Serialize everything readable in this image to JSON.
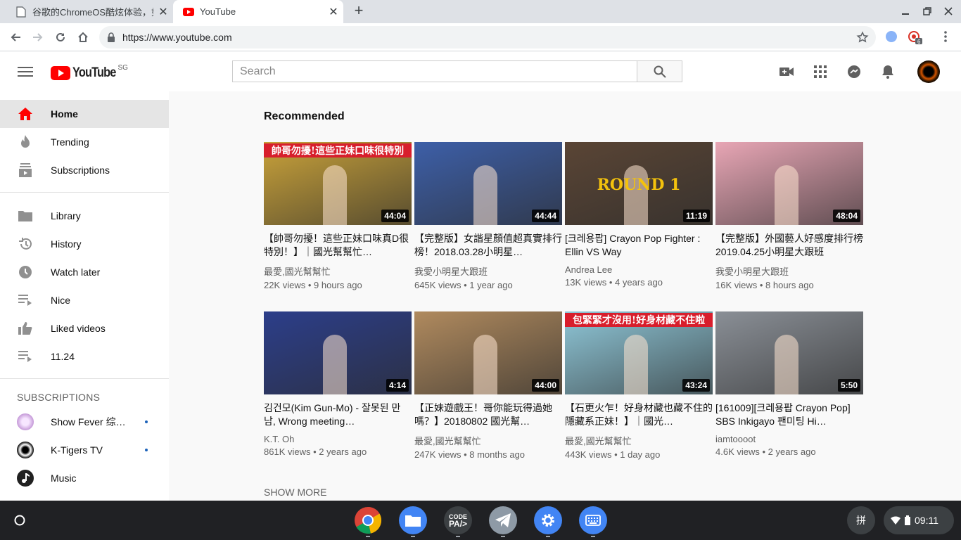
{
  "browser": {
    "tabs": [
      {
        "title": "谷歌的ChromeOS酷炫体验，如",
        "active": false
      },
      {
        "title": "YouTube",
        "active": true
      }
    ],
    "url": "https://www.youtube.com"
  },
  "header": {
    "logo_text": "YouTube",
    "region": "SG",
    "search_placeholder": "Search"
  },
  "sidebar": {
    "items": [
      {
        "label": "Home",
        "icon": "home-icon",
        "selected": true
      },
      {
        "label": "Trending",
        "icon": "trending-icon"
      },
      {
        "label": "Subscriptions",
        "icon": "subscriptions-icon"
      },
      {
        "label": "Library",
        "icon": "library-icon"
      },
      {
        "label": "History",
        "icon": "history-icon"
      },
      {
        "label": "Watch later",
        "icon": "watch-later-icon"
      },
      {
        "label": "Nice",
        "icon": "playlist-icon"
      },
      {
        "label": "Liked videos",
        "icon": "thumbs-up-icon"
      },
      {
        "label": "11.24",
        "icon": "playlist-icon"
      }
    ],
    "subscriptions_title": "SUBSCRIPTIONS",
    "subscriptions": [
      {
        "label": "Show Fever 综…",
        "new": true
      },
      {
        "label": "K-Tigers TV",
        "new": true
      },
      {
        "label": "Music",
        "new": false
      }
    ]
  },
  "main": {
    "section_title": "Recommended",
    "videos": [
      {
        "title": "【帥哥勿擾！這些正妹口味真D很特別！】｜國光幫幫忙…",
        "channel": "最愛,國光幫幫忙",
        "meta": "22K views • 9 hours ago",
        "duration": "44:04",
        "thumb_color": "#c9a23a",
        "thumb_banner": "帥哥勿擾!這些正妹口味很特別",
        "banner_color": "#d81e2c"
      },
      {
        "title": "【完整版】女諧星顏值超真實排行榜！2018.03.28小明星…",
        "channel": "我愛小明星大跟班",
        "meta": "645K views • 1 year ago",
        "duration": "44:44",
        "thumb_color": "#3d5fa8",
        "thumb_banner": "",
        "banner_color": "#7b1fa2"
      },
      {
        "title": "[크레용팝] Crayon Pop Fighter : Ellin VS Way",
        "channel": "Andrea Lee",
        "meta": "13K views • 4 years ago",
        "duration": "11:19",
        "thumb_color": "#5a4535",
        "thumb_banner": "ROUND 1",
        "banner_color": "#f4c20d"
      },
      {
        "title": "【完整版】外國藝人好感度排行榜2019.04.25小明星大跟班",
        "channel": "我愛小明星大跟班",
        "meta": "16K views • 8 hours ago",
        "duration": "48:04",
        "thumb_color": "#e8a6b5",
        "thumb_banner": "",
        "banner_color": "#7b1fa2"
      },
      {
        "title": "김건모(Kim Gun-Mo) - 잘못된 만남, Wrong meeting…",
        "channel": "K.T. Oh",
        "meta": "861K views • 2 years ago",
        "duration": "4:14",
        "thumb_color": "#2c3e8a",
        "thumb_banner": "",
        "banner_color": "#000000"
      },
      {
        "title": "【正妹遊戲王！哥你能玩得過她嗎？】20180802 國光幫…",
        "channel": "最愛,國光幫幫忙",
        "meta": "247K views • 8 months ago",
        "duration": "44:00",
        "thumb_color": "#b08a5e",
        "thumb_banner": "",
        "banner_color": "#000000"
      },
      {
        "title": "【石更火乍！好身材藏也藏不住的隱藏系正妹！】｜國光…",
        "channel": "最愛,國光幫幫忙",
        "meta": "443K views • 1 day ago",
        "duration": "43:24",
        "thumb_color": "#8fc7d8",
        "thumb_banner": "包緊緊才沒用!好身材藏不住啦",
        "banner_color": "#d81e2c"
      },
      {
        "title": "[161009][크레용팝 Crayon Pop] SBS Inkigayo 팬미팅 Hi…",
        "channel": "iamtoooot",
        "meta": "4.6K views • 2 years ago",
        "duration": "5:50",
        "thumb_color": "#8a8f96",
        "thumb_banner": "",
        "banner_color": "#000000"
      }
    ],
    "show_more": "SHOW MORE"
  },
  "shelf": {
    "ime": "拼",
    "time": "09:11",
    "apps": [
      "chrome-icon",
      "files-icon",
      "code-pad-icon",
      "telegram-icon",
      "settings-icon",
      "keyboard-icon"
    ]
  }
}
